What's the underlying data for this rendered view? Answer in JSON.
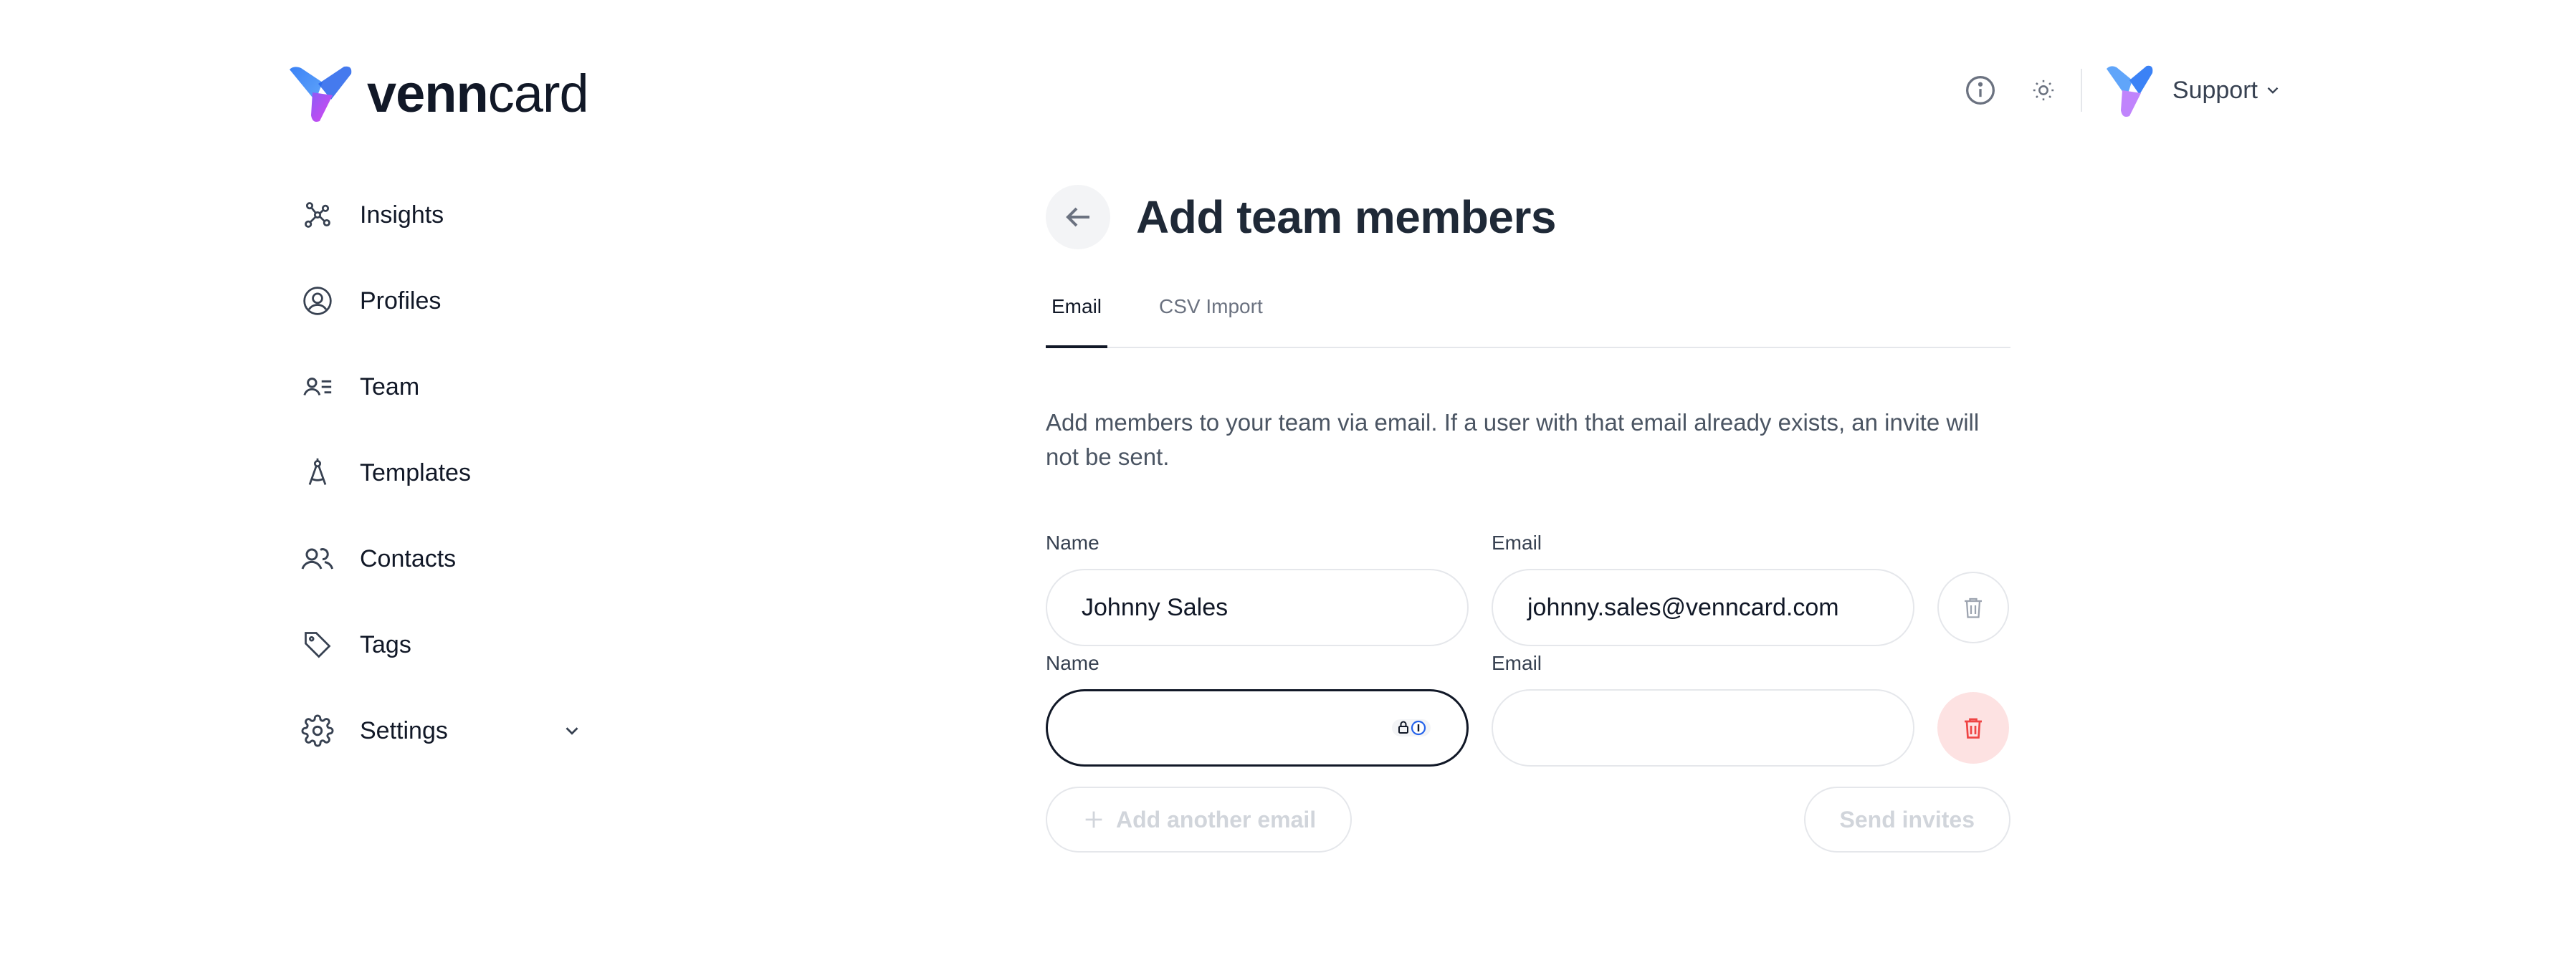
{
  "brand": {
    "name_bold": "venn",
    "name_light": "card"
  },
  "header": {
    "support_label": "Support"
  },
  "sidebar": {
    "items": [
      {
        "label": "Insights",
        "icon": "insights-icon"
      },
      {
        "label": "Profiles",
        "icon": "profile-icon"
      },
      {
        "label": "Team",
        "icon": "team-icon"
      },
      {
        "label": "Templates",
        "icon": "templates-icon"
      },
      {
        "label": "Contacts",
        "icon": "contacts-icon"
      },
      {
        "label": "Tags",
        "icon": "tag-icon"
      },
      {
        "label": "Settings",
        "icon": "gear-icon"
      }
    ]
  },
  "main": {
    "title": "Add team members",
    "tabs": [
      {
        "label": "Email",
        "active": true
      },
      {
        "label": "CSV Import",
        "active": false
      }
    ],
    "description": "Add members to your team via email. If a user with that email already exists, an invite will not be sent.",
    "rows": [
      {
        "name_label": "Name",
        "email_label": "Email",
        "name_value": "Johnny Sales",
        "email_value": "johnny.sales@venncard.com"
      },
      {
        "name_label": "Name",
        "email_label": "Email",
        "name_value": "",
        "email_value": ""
      }
    ],
    "add_another_label": "Add another email",
    "send_invites_label": "Send invites"
  },
  "colors": {
    "accent_text": "#111827",
    "danger": "#ef4444",
    "danger_bg": "#fde2e2",
    "muted": "#d1d5db"
  }
}
